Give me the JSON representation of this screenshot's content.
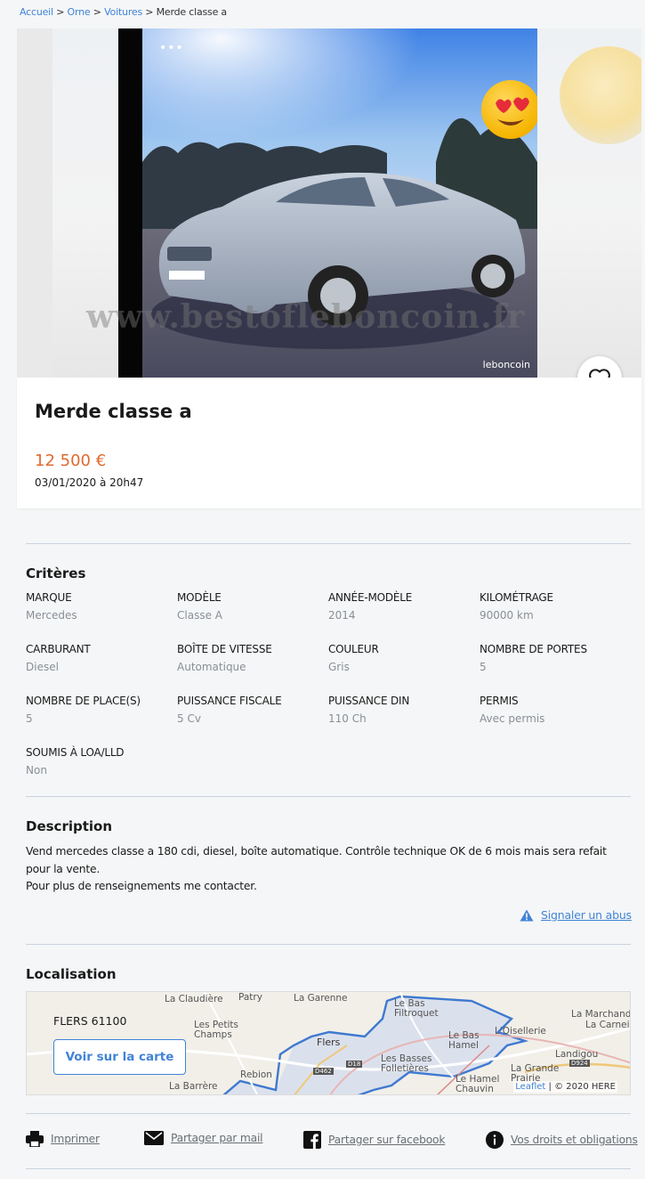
{
  "breadcrumb": {
    "items": [
      "Accueil",
      "Orne",
      "Voitures"
    ],
    "current": "Merde classe a",
    "separator": ">"
  },
  "gallery": {
    "more_icon": "more-dots-icon",
    "brand_overlay": "leboncoin",
    "watermark": "www.bestofleboncoin.fr",
    "favorite_icon": "heart-icon"
  },
  "ad": {
    "title": "Merde classe a",
    "price": "12 500 €",
    "date": "03/01/2020 à 20h47"
  },
  "criteria": {
    "title": "Critères",
    "items": [
      {
        "key": "Marque",
        "value": "Mercedes"
      },
      {
        "key": "Modèle",
        "value": "Classe A"
      },
      {
        "key": "Année-modèle",
        "value": "2014"
      },
      {
        "key": "Kilométrage",
        "value": "90000 km"
      },
      {
        "key": "Carburant",
        "value": "Diesel"
      },
      {
        "key": "Boîte de vitesse",
        "value": "Automatique"
      },
      {
        "key": "Couleur",
        "value": "Gris"
      },
      {
        "key": "Nombre de portes",
        "value": "5"
      },
      {
        "key": "Nombre de place(s)",
        "value": "5"
      },
      {
        "key": "Puissance fiscale",
        "value": "5 Cv"
      },
      {
        "key": "Puissance DIN",
        "value": "110 Ch"
      },
      {
        "key": "Permis",
        "value": "Avec permis"
      },
      {
        "key": "Soumis à LOA/LLD",
        "value": "Non"
      }
    ]
  },
  "description": {
    "title": "Description",
    "line1": "Vend mercedes classe a 180 cdi, diesel, boîte automatique. Contrôle technique OK de 6 mois mais sera refait pour la vente.",
    "line2": "Pour plus de renseignements me contacter.",
    "report_label": "Signaler un abus"
  },
  "location": {
    "title": "Localisation",
    "city": "FLERS 61100",
    "map_button": "Voir sur la carte",
    "places": [
      "Patry",
      "La Garenne",
      "Le Bas Filtroquet",
      "La Claudière",
      "Les Petits Champs",
      "Flers",
      "Le Bas Hamel",
      "L'Oisellerie",
      "La Marchand",
      "La Carneil",
      "Landigou",
      "Les Basses Folletières",
      "Le Hamel Chauvin",
      "La Grande Prairie",
      "Rebion",
      "La Barrère"
    ],
    "roads": [
      "D462",
      "D18",
      "D924"
    ],
    "attribution_link": "Leaflet",
    "attribution_text": "| © 2020 HERE"
  },
  "share": {
    "print": "Imprimer",
    "mail": "Partager par mail",
    "facebook": "Partager sur facebook",
    "rights": "Vos droits et obligations"
  },
  "colors": {
    "accent": "#4183d7",
    "price": "#e06a2e",
    "muted": "#8a8f96",
    "background": "#f4f6f7"
  }
}
